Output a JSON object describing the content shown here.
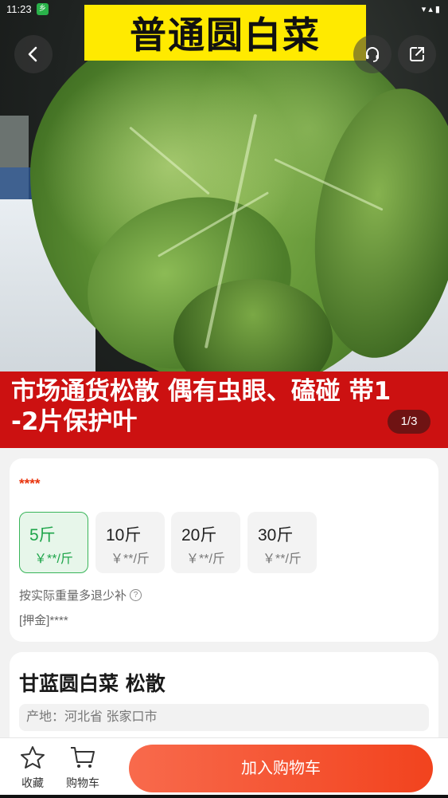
{
  "status_bar": {
    "time": "11:23",
    "app_badge": "乡",
    "right_icons": "▾ ▴ ▮"
  },
  "hero": {
    "title_banner": "普通圆白菜",
    "promo_line_1": "市场通货松散 偶有虫眼、磕碰 带1",
    "promo_line_2": "-2片保护叶",
    "page_indicator": "1/3",
    "icons": {
      "back": "chevron-left-icon",
      "service": "headset-icon",
      "share": "share-icon"
    }
  },
  "spec": {
    "price": "****",
    "options": [
      {
        "weight": "5斤",
        "price": "￥**/斤",
        "selected": true
      },
      {
        "weight": "10斤",
        "price": "￥**/斤",
        "selected": false
      },
      {
        "weight": "20斤",
        "price": "￥**/斤",
        "selected": false
      },
      {
        "weight": "30斤",
        "price": "￥**/斤",
        "selected": false
      }
    ],
    "refund_note": "按实际重量多退少补",
    "deposit": "[押金]****"
  },
  "product": {
    "name": "甘蓝圆白菜 松散",
    "origin": "产地：河北省 张家口市"
  },
  "bottom_bar": {
    "favorite_label": "收藏",
    "cart_label": "购物车",
    "add_to_cart": "加入购物车"
  },
  "colors": {
    "accent_red": "#cc1111",
    "price_red": "#e8320b",
    "selected_green": "#1ea54a",
    "cta": "#f2431e",
    "title_yellow": "#ffea00"
  }
}
